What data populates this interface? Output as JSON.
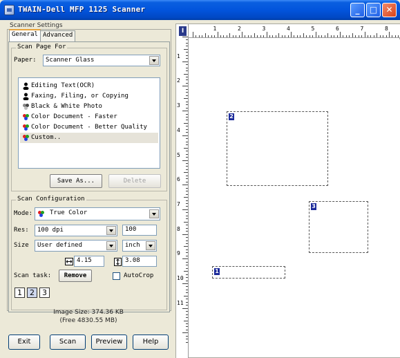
{
  "window": {
    "title": "TWAIN-Dell MFP 1125 Scanner",
    "minimize": "_",
    "maximize": "□",
    "close": "✕"
  },
  "settings_group": "Scanner Settings",
  "tabs": [
    {
      "label": "General"
    },
    {
      "label": "Advanced"
    }
  ],
  "scan_page_for": {
    "legend": "Scan Page For",
    "paper_label": "Paper:",
    "paper_value": "Scanner Glass",
    "items": [
      {
        "label": "Editing Text(OCR)",
        "icon": "person-icon",
        "color": "#000000"
      },
      {
        "label": "Faxing, Filing, or Copying",
        "icon": "person-icon",
        "color": "#000000"
      },
      {
        "label": "Black & White Photo",
        "icon": "grayscale-photo-icon",
        "color": "#808080"
      },
      {
        "label": "Color Document - Faster",
        "icon": "color-icon",
        "color": "#e02020"
      },
      {
        "label": "Color Document - Better Quality",
        "icon": "color-icon",
        "color": "#e02020"
      },
      {
        "label": "Custom..",
        "icon": "color-icon",
        "color": "#e02020",
        "selected": true
      }
    ],
    "save_as": "Save As...",
    "delete": "Delete"
  },
  "scan_config": {
    "legend": "Scan Configuration",
    "mode_label": "Mode:",
    "mode_value": "True Color",
    "res_label": "Res:",
    "res_value": "100 dpi",
    "res_input": "100",
    "size_label": "Size",
    "size_value": "User defined",
    "unit_value": "inch",
    "width_value": "4.15",
    "height_value": "3.08",
    "task_label": "Scan task:",
    "remove": "Remove",
    "autocrop": "AutoCrop",
    "tasks": [
      "1",
      "2",
      "3"
    ]
  },
  "image_size": "Image Size: 374.36 KB",
  "free_size": "(Free 4830.55 MB)",
  "buttons": {
    "exit": "Exit",
    "scan": "Scan",
    "preview": "Preview",
    "help": "Help"
  },
  "ruler": {
    "corner": "I",
    "top": [
      "1",
      "2",
      "3",
      "4",
      "5",
      "6",
      "7",
      "8"
    ],
    "left": [
      "1",
      "2",
      "3",
      "4",
      "5",
      "6",
      "7",
      "8",
      "9",
      "10",
      "11"
    ]
  },
  "scan_areas": [
    {
      "label": "2"
    },
    {
      "label": "3"
    },
    {
      "label": "1"
    }
  ],
  "colors": {
    "titlebar": "#0254dc",
    "task_marker": "#1b2a9a"
  }
}
